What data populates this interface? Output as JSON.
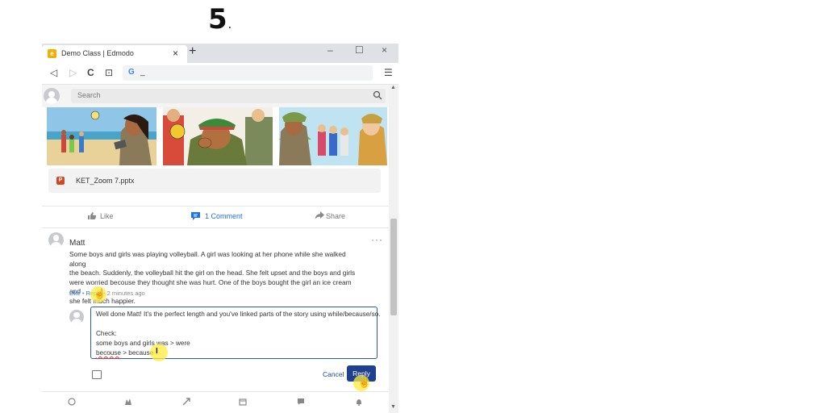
{
  "step": {
    "number": "5",
    "dot": "."
  },
  "browser": {
    "tab_title": "Demo Class | Edmodo",
    "tab_close": "×",
    "new_tab": "+",
    "window_controls": {
      "minimize": "–",
      "maximize": "☐",
      "close": "×"
    },
    "nav": {
      "back": "◁",
      "forward": "▷",
      "reload": "C",
      "bookmark": "⊡"
    },
    "address_value": "_",
    "menu": "☰"
  },
  "edmodo": {
    "search_placeholder": "Search",
    "attachment": "KET_Zoom 7.pptx",
    "attachment_badge": "P",
    "actions": {
      "like": "Like",
      "comment": "1 Comment",
      "share": "Share"
    },
    "comment": {
      "author": "Matt",
      "more": "···",
      "lines": [
        "Some boys and girls was playing volleyball. A girl was looking at her phone while she walked along",
        "the beach. Suddenly, the volleyball hit the girl on the head. She felt upset and the boys and girls",
        "were worried becouse they thought she was hurt. One of the boys bought the girl an ice cream and",
        "she felt much happier."
      ],
      "meta": {
        "like": "Like",
        "bullet": "•",
        "reply": "Reply",
        "time": "2 minutes ago"
      }
    },
    "reply_box": {
      "line1": "Well done Matt! It's the perfect length and you've linked parts of the story using while/because/so.",
      "line2": "Check:",
      "line3": "some boys and girls was > were",
      "line4_wrong": "becouse",
      "line4_rest": " > because"
    },
    "cancel_label": "Cancel",
    "reply_label": "Reply",
    "text_cursor": "I"
  },
  "colors": {
    "accent": "#1f3f8f",
    "link": "#1a73e8",
    "highlight": "#ffec3c"
  }
}
